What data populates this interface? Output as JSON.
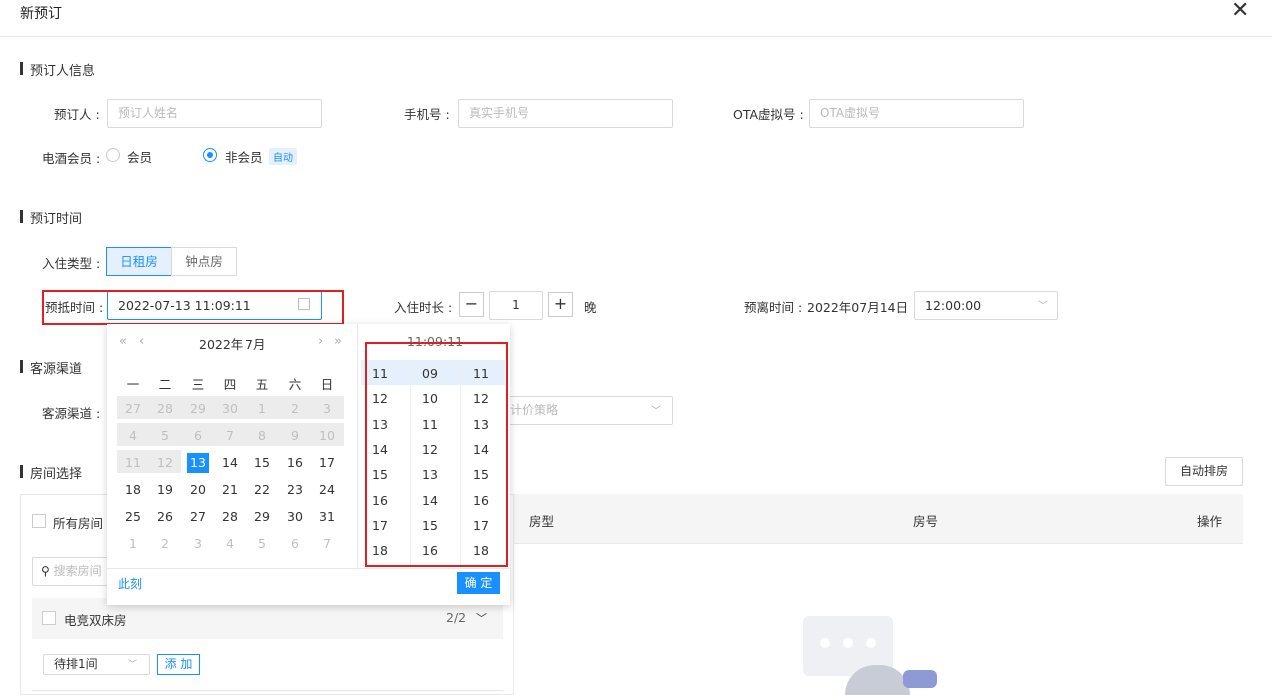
{
  "dialog": {
    "title": "新预订",
    "close_icon": "close-icon"
  },
  "booker": {
    "section_title": "预订人信息",
    "name_label": "预订人 :",
    "name_placeholder": "预订人姓名",
    "phone_label": "手机号 :",
    "phone_placeholder": "真实手机号",
    "ota_label": "OTA虚拟号 :",
    "ota_placeholder": "OTA虚拟号",
    "member_label": "电酒会员 :",
    "member_option": "会员",
    "nonmember_option": "非会员",
    "auto_tag": "自动",
    "selected": "非会员"
  },
  "time": {
    "section_title": "预订时间",
    "checkin_type_label": "入住类型 :",
    "type_day": "日租房",
    "type_hour": "钟点房",
    "type_selected": "日租房",
    "arrive_label": "预抵时间 :",
    "arrive_value": "2022-07-13 11:09:11",
    "duration_label": "入住时长 :",
    "duration_value": "1",
    "duration_unit": "晚",
    "minus": "−",
    "plus": "+",
    "depart_label": "预离时间 :",
    "depart_date": "2022年07月14日",
    "depart_time": "12:00:00"
  },
  "source": {
    "section_title": "客源渠道",
    "channel_label": "客源渠道 :",
    "price_policy_placeholder": "计价策略"
  },
  "rooms": {
    "section_title": "房间选择",
    "auto_assign": "自动排房",
    "all_rooms": "所有房间",
    "search_placeholder": "搜索房间",
    "room_type_name": "电竞双床房",
    "room_type_count": "2/2",
    "pending_select": "待排1间",
    "add_button": "添 加",
    "table_headers": [
      "房型",
      "房号",
      "操作"
    ]
  },
  "datepicker": {
    "year_label": "2022年",
    "month_label": "7月",
    "weekdays": [
      "一",
      "二",
      "三",
      "四",
      "五",
      "六",
      "日"
    ],
    "weeks": [
      [
        "27",
        "28",
        "29",
        "30",
        "1",
        "2",
        "3"
      ],
      [
        "4",
        "5",
        "6",
        "7",
        "8",
        "9",
        "10"
      ],
      [
        "11",
        "12",
        "13",
        "14",
        "15",
        "16",
        "17"
      ],
      [
        "18",
        "19",
        "20",
        "21",
        "22",
        "23",
        "24"
      ],
      [
        "25",
        "26",
        "27",
        "28",
        "29",
        "30",
        "31"
      ],
      [
        "1",
        "2",
        "3",
        "4",
        "5",
        "6",
        "7"
      ]
    ],
    "selected_day": "13",
    "now_label": "此刻",
    "ok_label": "确 定",
    "time_header": "11:09:11",
    "hours": [
      "11",
      "12",
      "13",
      "14",
      "15",
      "16",
      "17",
      "18"
    ],
    "minutes": [
      "09",
      "10",
      "11",
      "12",
      "13",
      "14",
      "15",
      "16"
    ],
    "seconds": [
      "11",
      "12",
      "13",
      "14",
      "15",
      "16",
      "17",
      "18"
    ]
  },
  "colors": {
    "accent": "#1890ff",
    "highlight": "#e02020"
  }
}
